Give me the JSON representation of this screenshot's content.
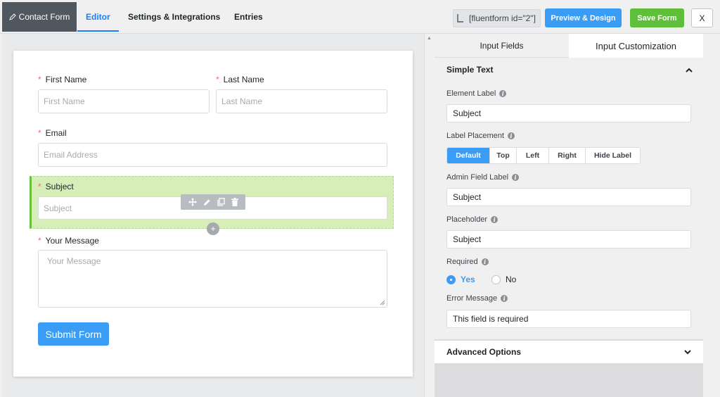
{
  "topbar": {
    "brand_label": "Contact Form",
    "tabs": [
      {
        "label": "Editor",
        "active": true
      },
      {
        "label": "Settings & Integrations",
        "active": false
      },
      {
        "label": "Entries",
        "active": false
      }
    ],
    "shortcode": "[fluentform id=\"2\"]",
    "preview_label": "Preview & Design",
    "save_label": "Save Form",
    "close_label": "X"
  },
  "form": {
    "first_name": {
      "label": "First Name",
      "placeholder": "First Name",
      "required": true
    },
    "last_name": {
      "label": "Last Name",
      "placeholder": "Last Name",
      "required": true
    },
    "email": {
      "label": "Email",
      "placeholder": "Email Address",
      "required": true
    },
    "subject": {
      "label": "Subject",
      "placeholder": "Subject",
      "required": true,
      "selected": true
    },
    "message": {
      "label": "Your Message",
      "placeholder": "Your Message",
      "required": true
    },
    "required_mark": "*",
    "submit_label": "Submit Form",
    "add_symbol": "+"
  },
  "panel": {
    "tabs": [
      {
        "label": "Input Fields",
        "active": false
      },
      {
        "label": "Input Customization",
        "active": true
      }
    ],
    "section_title": "Simple Text",
    "element_label": {
      "label": "Element Label",
      "value": "Subject"
    },
    "label_placement": {
      "label": "Label Placement",
      "options": [
        "Default",
        "Top",
        "Left",
        "Right",
        "Hide Label"
      ],
      "selected": "Default"
    },
    "admin_field_label": {
      "label": "Admin Field Label",
      "value": "Subject"
    },
    "placeholder": {
      "label": "Placeholder",
      "value": "Subject"
    },
    "required": {
      "label": "Required",
      "options": [
        "Yes",
        "No"
      ],
      "selected": "Yes"
    },
    "error_message": {
      "label": "Error Message",
      "value": "This field is required"
    },
    "advanced_options": "Advanced Options",
    "info_glyph": "i"
  },
  "colors": {
    "accent": "#3a9cf5",
    "save": "#5fbf3a",
    "selected_field_bg": "#d7eeb8",
    "required_mark": "#f56c6c"
  }
}
